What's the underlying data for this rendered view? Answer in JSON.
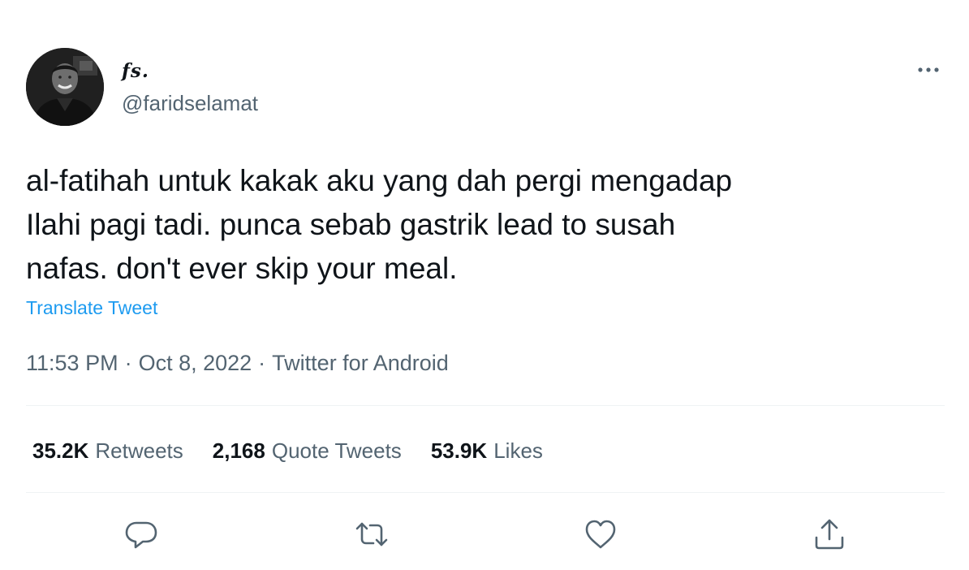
{
  "author": {
    "display_name": "fs.",
    "handle": "@faridselamat"
  },
  "tweet": {
    "text": "al-fatihah untuk kakak aku yang dah pergi mengadap\nIlahi pagi tadi. punca sebab gastrik lead to susah\nnafas. don't ever skip your meal.",
    "translate_label": "Translate Tweet",
    "time": "11:53 PM",
    "date": "Oct 8, 2022",
    "source": "Twitter for Android",
    "separator": "·"
  },
  "stats": {
    "retweets_count": "35.2K",
    "retweets_label": "Retweets",
    "quotes_count": "2,168",
    "quotes_label": "Quote Tweets",
    "likes_count": "53.9K",
    "likes_label": "Likes"
  },
  "icons": {
    "more": "more-horizontal-icon",
    "reply": "reply-icon",
    "retweet": "retweet-icon",
    "like": "heart-icon",
    "share": "share-icon"
  },
  "colors": {
    "text_primary": "#0f1419",
    "text_secondary": "#536471",
    "link": "#1d9bf0",
    "divider": "#eff3f4"
  }
}
